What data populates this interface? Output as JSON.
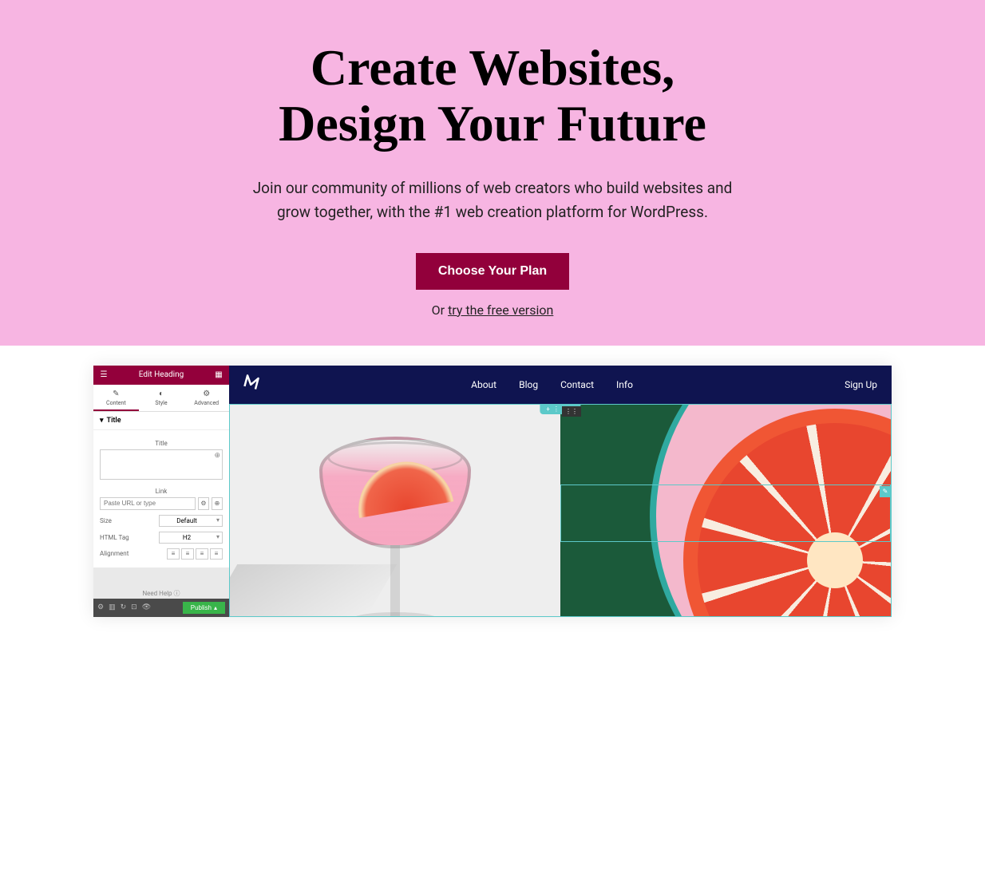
{
  "hero": {
    "heading_line1": "Create Websites,",
    "heading_line2": "Design Your Future",
    "subheading": "Join our community of millions of web creators who build websites and grow together, with the #1 web creation platform for WordPress.",
    "cta_label": "Choose Your Plan",
    "or_text": "Or ",
    "free_link": "try the free version"
  },
  "editor": {
    "header_title": "Edit Heading",
    "tabs": {
      "content": "Content",
      "style": "Style",
      "advanced": "Advanced"
    },
    "accordion_title": "Title",
    "title_label": "Title",
    "link_label": "Link",
    "link_placeholder": "Paste URL or type",
    "size_label": "Size",
    "size_value": "Default",
    "htmltag_label": "HTML Tag",
    "htmltag_value": "H2",
    "alignment_label": "Alignment",
    "need_help": "Need Help",
    "publish": "Publish"
  },
  "preview": {
    "nav": {
      "about": "About",
      "blog": "Blog",
      "contact": "Contact",
      "info": "Info",
      "signup": "Sign Up"
    }
  }
}
